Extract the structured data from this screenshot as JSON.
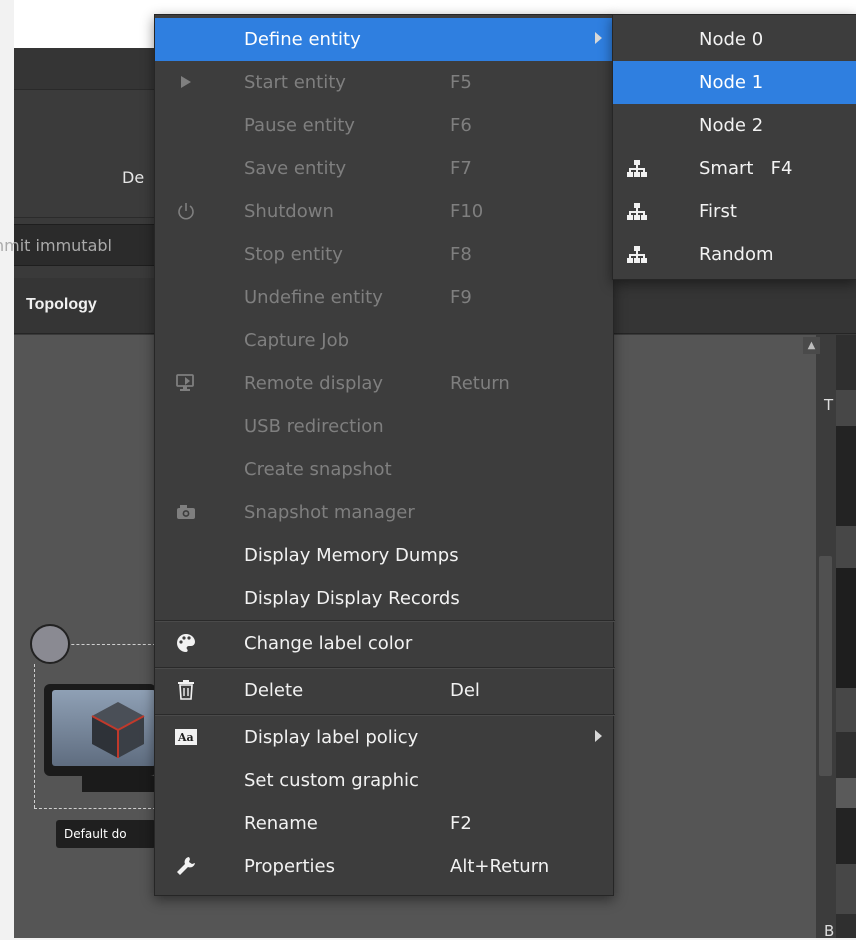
{
  "background": {
    "panel_label": "De",
    "commit_input_text": "nmit immutabl",
    "tab_topology": "Topology",
    "right_panel_top_letter": "T",
    "right_panel_bottom_letter": "B",
    "device_label": "Default do"
  },
  "context_menu": {
    "items": [
      {
        "label": "Define entity",
        "shortcut": "",
        "state": "highlighted",
        "icon": "",
        "has_submenu": true
      },
      {
        "label": "Start entity",
        "shortcut": "F5",
        "state": "disabled",
        "icon": "play-icon"
      },
      {
        "label": "Pause entity",
        "shortcut": "F6",
        "state": "disabled",
        "icon": ""
      },
      {
        "label": "Save entity",
        "shortcut": "F7",
        "state": "disabled",
        "icon": ""
      },
      {
        "label": "Shutdown",
        "shortcut": "F10",
        "state": "disabled",
        "icon": "power-icon"
      },
      {
        "label": "Stop entity",
        "shortcut": "F8",
        "state": "disabled",
        "icon": ""
      },
      {
        "label": "Undefine entity",
        "shortcut": "F9",
        "state": "disabled",
        "icon": ""
      },
      {
        "label": "Capture Job",
        "shortcut": "",
        "state": "disabled",
        "icon": ""
      },
      {
        "label": "Remote display",
        "shortcut": "Return",
        "state": "disabled",
        "icon": "remote-display-icon"
      },
      {
        "label": "USB redirection",
        "shortcut": "",
        "state": "disabled",
        "icon": ""
      },
      {
        "label": "Create snapshot",
        "shortcut": "",
        "state": "disabled",
        "icon": ""
      },
      {
        "label": "Snapshot manager",
        "shortcut": "",
        "state": "disabled",
        "icon": "camera-icon"
      },
      {
        "label": "Display Memory Dumps",
        "shortcut": "",
        "state": "enabled",
        "icon": ""
      },
      {
        "label": "Display Display Records",
        "shortcut": "",
        "state": "enabled",
        "icon": ""
      },
      {
        "label": "Change label color",
        "shortcut": "",
        "state": "enabled",
        "icon": "palette-icon"
      },
      {
        "label": "Delete",
        "shortcut": "Del",
        "state": "enabled",
        "icon": "trash-icon"
      },
      {
        "label": "Display label policy",
        "shortcut": "",
        "state": "enabled",
        "icon": "text-format-icon",
        "has_submenu": true
      },
      {
        "label": "Set custom graphic",
        "shortcut": "",
        "state": "enabled",
        "icon": ""
      },
      {
        "label": "Rename",
        "shortcut": "F2",
        "state": "enabled",
        "icon": ""
      },
      {
        "label": "Properties",
        "shortcut": "Alt+Return",
        "state": "enabled",
        "icon": "wrench-icon"
      }
    ]
  },
  "submenu": {
    "items": [
      {
        "label": "Node 0",
        "state": "enabled",
        "icon": ""
      },
      {
        "label": "Node 1",
        "state": "highlighted",
        "icon": ""
      },
      {
        "label": "Node 2",
        "state": "enabled",
        "icon": ""
      },
      {
        "label": "Smart   F4",
        "state": "enabled",
        "icon": "hierarchy-icon"
      },
      {
        "label": "First",
        "state": "enabled",
        "icon": "hierarchy-icon"
      },
      {
        "label": "Random",
        "state": "enabled",
        "icon": "hierarchy-icon"
      }
    ]
  },
  "colors": {
    "highlight": "#2f7fe0",
    "menu_background": "#3d3d3d",
    "disabled_text": "#7f7f7f",
    "enabled_text": "#f2f2f2"
  }
}
